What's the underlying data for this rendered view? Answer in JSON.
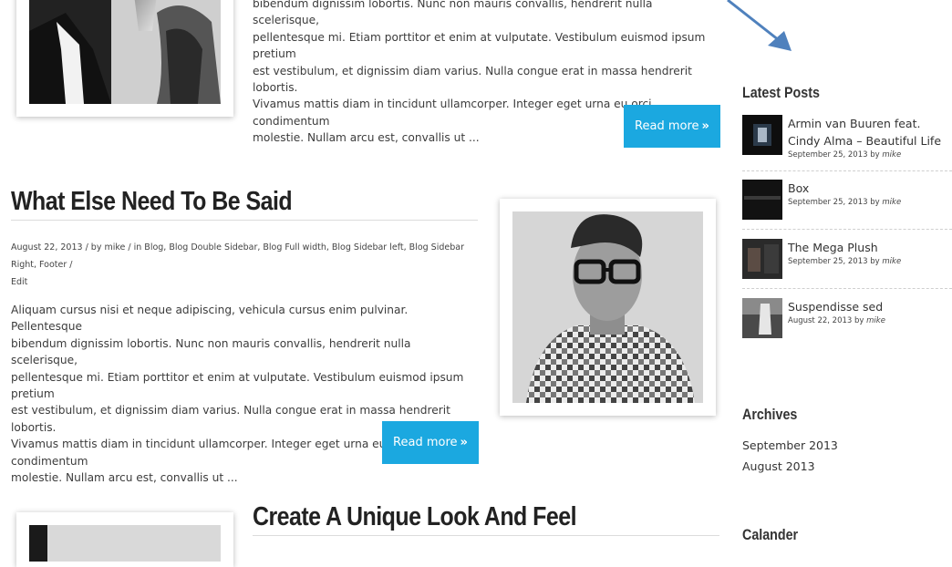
{
  "posts": [
    {
      "excerpt_tail": "bibendum dignissim lobortis. Nunc non mauris convallis, hendrerit nulla scelerisque,\npellentesque mi. Etiam porttitor et enim at vulputate. Vestibulum euismod ipsum pretium\nest vestibulum, et dignissim diam varius. Nulla congue erat in massa hendrerit lobortis.\nVivamus mattis diam in tincidunt ullamcorper. Integer eget urna eu orci condimentum\nmolestie. Nullam arcu est, convallis ut ...",
      "read_more": "Read more"
    },
    {
      "title": "What Else Need To Be Said",
      "meta": "August 22, 2013 / by mike / in Blog, Blog Double Sidebar, Blog Full width, Blog Sidebar left, Blog Sidebar Right, Footer /",
      "meta_edit": "Edit",
      "excerpt": "Aliquam cursus nisi et neque adipiscing, vehicula cursus enim pulvinar. Pellentesque\nbibendum dignissim lobortis. Nunc non mauris convallis, hendrerit nulla scelerisque,\npellentesque mi. Etiam porttitor et enim at vulputate. Vestibulum euismod ipsum pretium\nest vestibulum, et dignissim diam varius. Nulla congue erat in massa hendrerit lobortis.\nVivamus mattis diam in tincidunt ullamcorper. Integer eget urna eu orci condimentum\nmolestie. Nullam arcu est, convallis ut ...",
      "read_more": "Read more"
    },
    {
      "title": "Create A Unique Look And Feel"
    }
  ],
  "sidebar": {
    "latest_posts_title": "Latest Posts",
    "latest_posts": [
      {
        "title": "Armin van Buuren feat. Cindy Alma – Beautiful Life",
        "date": "September 25, 2013 by",
        "author": "mike"
      },
      {
        "title": "Box",
        "date": "September 25, 2013 by",
        "author": "mike"
      },
      {
        "title": "The Mega Plush",
        "date": "September 25, 2013 by",
        "author": "mike"
      },
      {
        "title": "Suspendisse sed",
        "date": "August 22, 2013 by",
        "author": "mike"
      }
    ],
    "archives_title": "Archives",
    "archives": [
      "September 2013",
      "August 2013"
    ],
    "calendar_title": "Calander"
  },
  "icons": {
    "read_more": "double-chevron-right-icon",
    "annotation": "arrow-annotation-icon"
  },
  "colors": {
    "accent": "#1ba8e0",
    "arrow": "#4f81bd"
  }
}
